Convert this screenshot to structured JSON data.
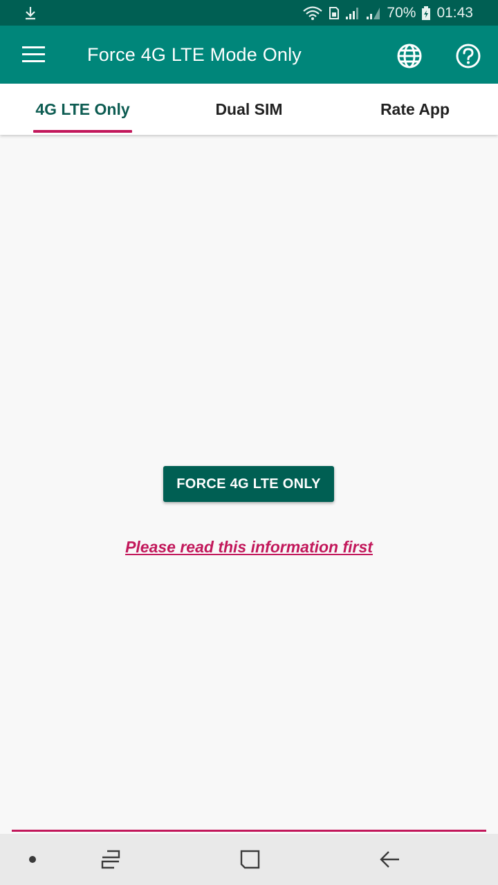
{
  "status_bar": {
    "battery_percent": "70%",
    "time": "01:43",
    "icons": [
      "download-icon",
      "wifi-icon",
      "sim-icon",
      "signal-icon",
      "signal-icon",
      "battery-icon"
    ]
  },
  "app_bar": {
    "title": "Force 4G LTE Mode Only",
    "icons": [
      "menu-icon",
      "globe-icon",
      "help-icon"
    ]
  },
  "tabs": [
    {
      "label": "4G LTE Only",
      "selected": true
    },
    {
      "label": "Dual SIM",
      "selected": false
    },
    {
      "label": "Rate App",
      "selected": false
    }
  ],
  "main": {
    "force_button_label": "FORCE 4G LTE ONLY",
    "info_link": "Please read this information first"
  },
  "nav_bar": {
    "icons": [
      "dot-icon",
      "recents-icon",
      "home-icon",
      "back-icon"
    ]
  },
  "colors": {
    "primary": "#00867a",
    "primary_dark": "#005f53",
    "accent": "#c2185b",
    "background": "#f8f8f8"
  }
}
